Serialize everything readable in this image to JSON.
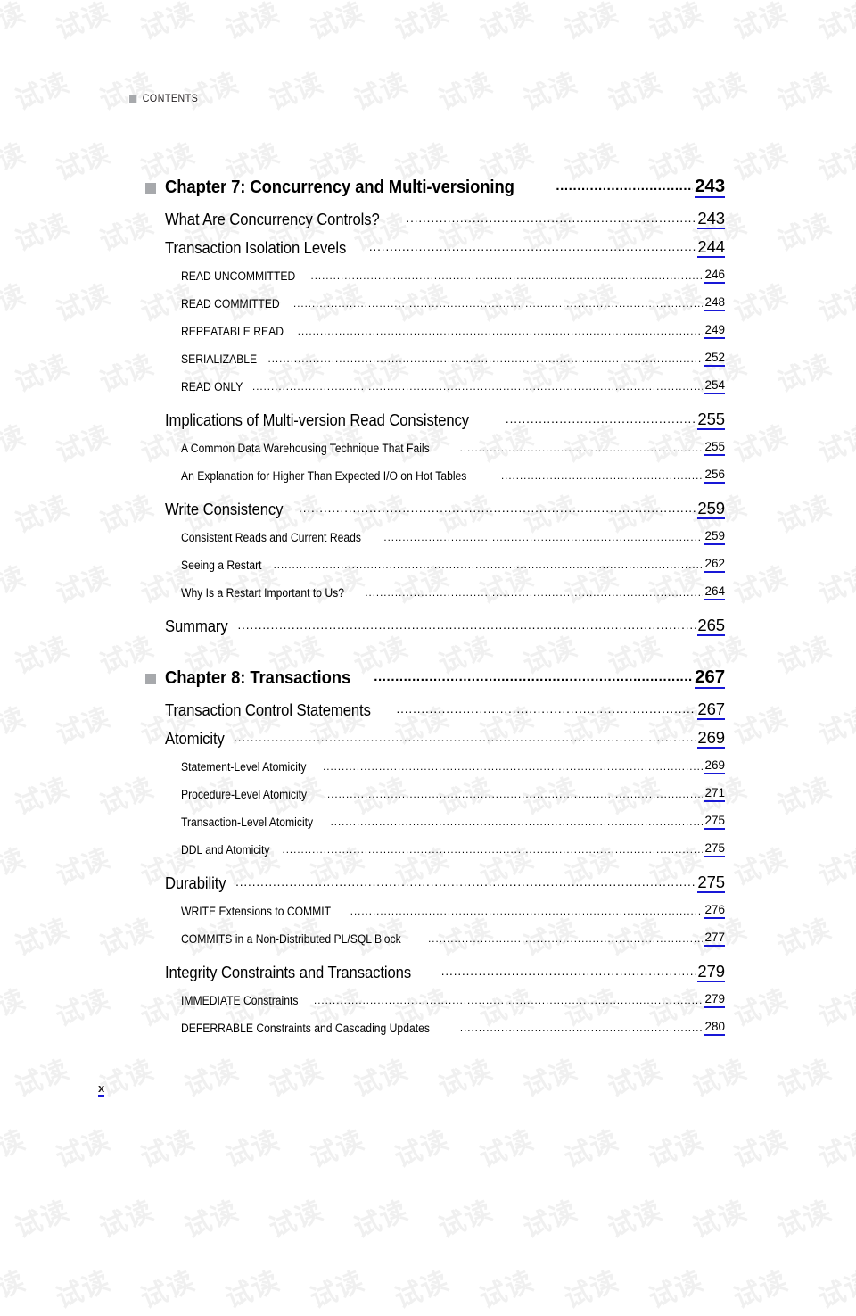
{
  "page": {
    "running_head": "CONTENTS",
    "folio": "x",
    "accent_link_color": "#1818d6",
    "bullet_color": "#a7a9ac",
    "watermark_text": "试读"
  },
  "toc": {
    "entries": [
      {
        "level": "chapter",
        "title": "Chapter 7: Concurrency and Multi-versioning",
        "page": "243"
      },
      {
        "level": "section",
        "title": "What Are Concurrency Controls?",
        "page": "243"
      },
      {
        "level": "section",
        "title": "Transaction Isolation Levels",
        "page": "244"
      },
      {
        "level": "sub",
        "title": "READ UNCOMMITTED",
        "page": "246"
      },
      {
        "level": "sub",
        "title": "READ COMMITTED",
        "page": "248"
      },
      {
        "level": "sub",
        "title": "REPEATABLE READ",
        "page": "249"
      },
      {
        "level": "sub",
        "title": "SERIALIZABLE",
        "page": "252"
      },
      {
        "level": "sub",
        "title": "READ ONLY",
        "page": "254"
      },
      {
        "level": "section",
        "title": "Implications of Multi-version Read Consistency",
        "page": "255"
      },
      {
        "level": "sub",
        "title": "A Common Data Warehousing Technique That Fails",
        "page": "255"
      },
      {
        "level": "sub",
        "title": "An Explanation for Higher Than Expected I/O on Hot Tables",
        "page": "256"
      },
      {
        "level": "section",
        "title": "Write Consistency",
        "page": "259"
      },
      {
        "level": "sub",
        "title": "Consistent Reads and Current Reads",
        "page": "259"
      },
      {
        "level": "sub",
        "title": "Seeing a Restart",
        "page": "262"
      },
      {
        "level": "sub",
        "title": "Why Is a Restart Important to Us?",
        "page": "264"
      },
      {
        "level": "section",
        "title": "Summary",
        "page": "265"
      },
      {
        "level": "chapter",
        "title": "Chapter 8: Transactions",
        "page": "267"
      },
      {
        "level": "section",
        "title": "Transaction Control Statements",
        "page": "267"
      },
      {
        "level": "section",
        "title": "Atomicity",
        "page": "269"
      },
      {
        "level": "sub",
        "title": "Statement-Level Atomicity",
        "page": "269"
      },
      {
        "level": "sub",
        "title": "Procedure-Level Atomicity",
        "page": "271"
      },
      {
        "level": "sub",
        "title": "Transaction-Level Atomicity",
        "page": "275"
      },
      {
        "level": "sub",
        "title": "DDL and Atomicity",
        "page": "275"
      },
      {
        "level": "section",
        "title": "Durability",
        "page": "275"
      },
      {
        "level": "sub",
        "title": "WRITE Extensions to COMMIT",
        "page": "276"
      },
      {
        "level": "sub",
        "title": "COMMITS in a Non-Distributed PL/SQL Block",
        "page": "277"
      },
      {
        "level": "section",
        "title": "Integrity Constraints and Transactions",
        "page": "279"
      },
      {
        "level": "sub",
        "title": "IMMEDIATE Constraints",
        "page": "279"
      },
      {
        "level": "sub",
        "title": "DEFERRABLE Constraints and Cascading Updates",
        "page": "280"
      }
    ]
  }
}
